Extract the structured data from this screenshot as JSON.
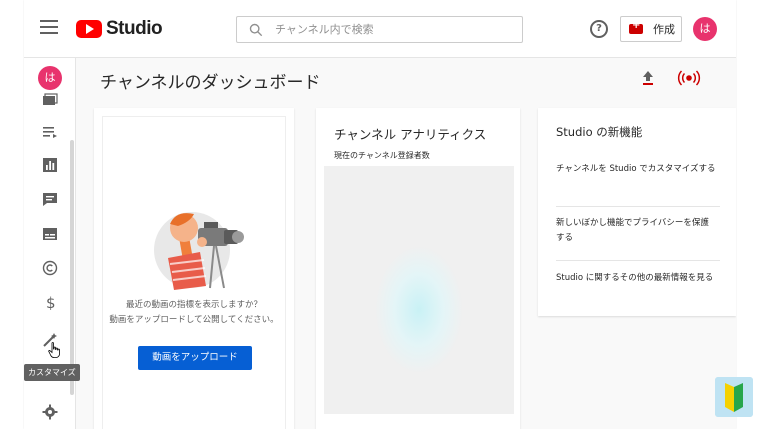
{
  "app": {
    "name": "Studio"
  },
  "header": {
    "search_placeholder": "チャンネル内で検索",
    "create_label": "作成",
    "avatar_initial": "は"
  },
  "sidebar": {
    "avatar_initial": "は",
    "tooltip": "カスタマイズ",
    "icons": [
      "content-icon",
      "playlist-icon",
      "analytics-icon",
      "comments-icon",
      "subtitles-icon",
      "copyright-icon",
      "monetization-icon",
      "customize-icon",
      "settings-icon"
    ]
  },
  "main": {
    "title": "チャンネルのダッシュボード",
    "upload_card": {
      "prompt_line1": "最近の動画の指標を表示しますか？",
      "prompt_line2": "動画をアップロードして公開してください。",
      "button": "動画をアップロード"
    },
    "analytics_card": {
      "title": "チャンネル アナリティクス",
      "subtitle": "現在のチャンネル登録者数"
    },
    "news_card": {
      "title": "Studio の新機能",
      "items": [
        "チャンネルを Studio でカスタマイズする",
        "新しいぼかし機能でプライバシーを保護する",
        "Studio に関するその他の最新情報を見る"
      ]
    }
  },
  "colors": {
    "brand_red": "#ff0000",
    "avatar_pink": "#e8336d",
    "primary_blue": "#065fd4"
  }
}
